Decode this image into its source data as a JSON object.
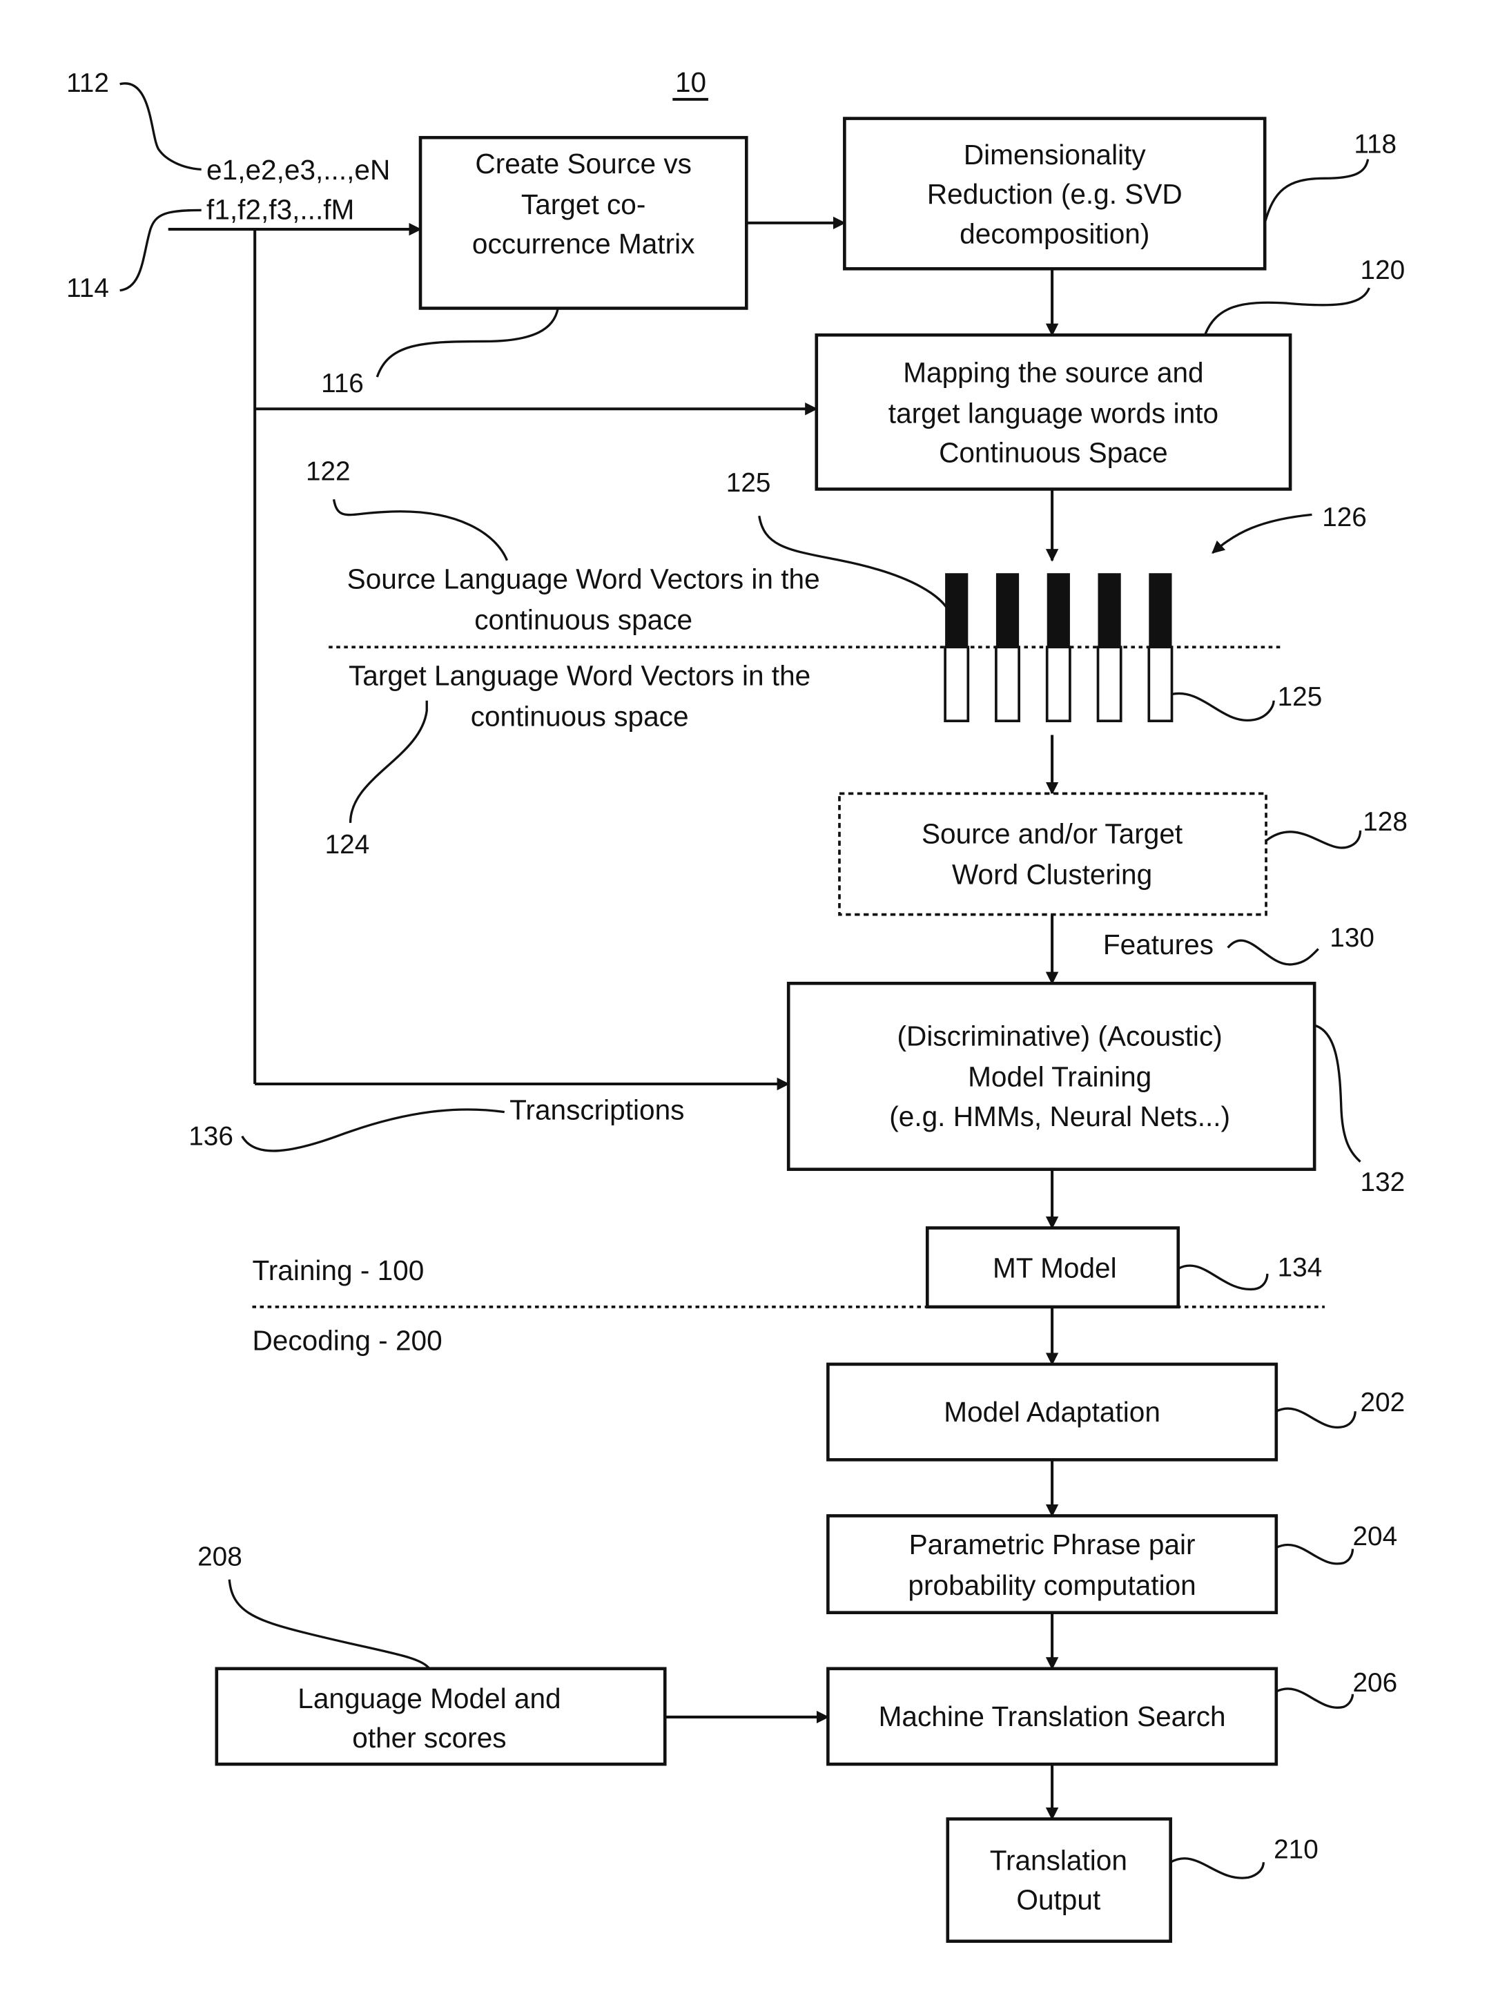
{
  "figure_number": "10",
  "inputs": {
    "source_sequence": "e1,e2,e3,...,eN",
    "target_sequence": "f1,f2,f3,...fM"
  },
  "blocks": {
    "cooccurrence": [
      "Create Source vs",
      "Target co-",
      "occurrence Matrix"
    ],
    "dim_reduction": [
      "Dimensionality",
      "Reduction (e.g. SVD",
      "decomposition)"
    ],
    "mapping": [
      "Mapping the source and",
      "target language words into",
      "Continuous Space"
    ],
    "clustering": [
      "Source and/or Target",
      "Word Clustering"
    ],
    "model_training": [
      "(Discriminative) (Acoustic)",
      "Model Training",
      "(e.g. HMMs, Neural Nets...)"
    ],
    "mt_model": [
      "MT Model"
    ],
    "adaptation": [
      "Model Adaptation"
    ],
    "phrase_prob": [
      "Parametric Phrase pair",
      "probability computation"
    ],
    "language_model": [
      "Language Model and",
      "other scores"
    ],
    "mt_search": [
      "Machine Translation Search"
    ],
    "output": [
      "Translation",
      "Output"
    ]
  },
  "labels": {
    "source_vectors": [
      "Source Language Word Vectors in the",
      "continuous space"
    ],
    "target_vectors": [
      "Target Language Word Vectors in the",
      "continuous space"
    ],
    "features": "Features",
    "transcriptions": "Transcriptions",
    "training": "Training - 100",
    "decoding": "Decoding - 200"
  },
  "refs": {
    "r112": "112",
    "r114": "114",
    "r116": "116",
    "r118": "118",
    "r120": "120",
    "r122": "122",
    "r124": "124",
    "r125a": "125",
    "r125b": "125",
    "r126": "126",
    "r128": "128",
    "r130": "130",
    "r132": "132",
    "r134": "134",
    "r136": "136",
    "r202": "202",
    "r204": "204",
    "r206": "206",
    "r208": "208",
    "r210": "210"
  },
  "vector_count": 5
}
